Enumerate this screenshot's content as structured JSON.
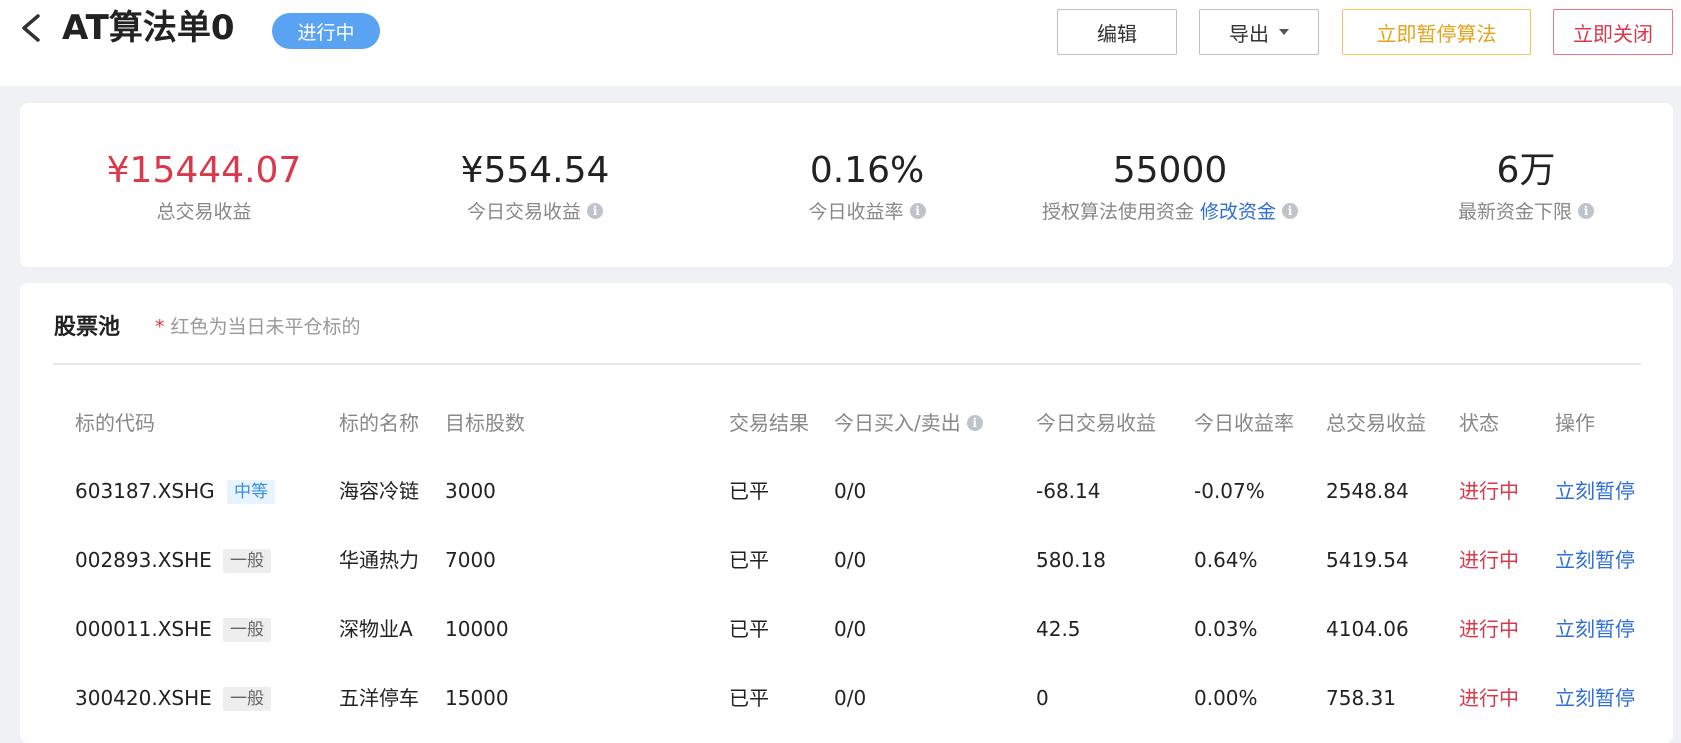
{
  "header": {
    "title": "AT算法单0",
    "status": "进行中",
    "buttons": {
      "edit": "编辑",
      "export": "导出",
      "pause_now": "立即暂停算法",
      "close_now": "立即关闭"
    }
  },
  "stats": [
    {
      "value": "¥15444.07",
      "label": "总交易收益",
      "info": false
    },
    {
      "value": "¥554.54",
      "label": "今日交易收益",
      "info": true
    },
    {
      "value": "0.16%",
      "label": "今日收益率",
      "info": true
    },
    {
      "value": "55000",
      "label": "授权算法使用资金",
      "link": "修改资金",
      "info": true
    },
    {
      "value": "6万",
      "label": "最新资金下限",
      "info": true
    }
  ],
  "pool": {
    "title": "股票池",
    "note_star": "*",
    "note": "红色为当日未平仓标的",
    "columns": [
      "标的代码",
      "标的名称",
      "目标股数",
      "交易结果",
      "今日买入/卖出",
      "今日交易收益",
      "今日收益率",
      "总交易收益",
      "状态",
      "操作"
    ],
    "rows": [
      {
        "code": "603187.XSHG",
        "tag": "中等",
        "name": "海容冷链",
        "shares": "3000",
        "result": "已平",
        "buysell": "0/0",
        "today_profit": "-68.14",
        "today_rate": "-0.07%",
        "total_profit": "2548.84",
        "status": "进行中",
        "action": "立刻暂停"
      },
      {
        "code": "002893.XSHE",
        "tag": "一般",
        "name": "华通热力",
        "shares": "7000",
        "result": "已平",
        "buysell": "0/0",
        "today_profit": "580.18",
        "today_rate": "0.64%",
        "total_profit": "5419.54",
        "status": "进行中",
        "action": "立刻暂停"
      },
      {
        "code": "000011.XSHE",
        "tag": "一般",
        "name": "深物业A",
        "shares": "10000",
        "result": "已平",
        "buysell": "0/0",
        "today_profit": "42.5",
        "today_rate": "0.03%",
        "total_profit": "4104.06",
        "status": "进行中",
        "action": "立刻暂停"
      },
      {
        "code": "300420.XSHE",
        "tag": "一般",
        "name": "五洋停车",
        "shares": "15000",
        "result": "已平",
        "buysell": "0/0",
        "today_profit": "0",
        "today_rate": "0.00%",
        "total_profit": "758.31",
        "status": "进行中",
        "action": "立刻暂停"
      }
    ]
  },
  "colors": {
    "accent_blue": "#5aa2f2",
    "link_blue": "#2f6fd6",
    "red": "#d9394a",
    "orange": "#e3a31a"
  }
}
